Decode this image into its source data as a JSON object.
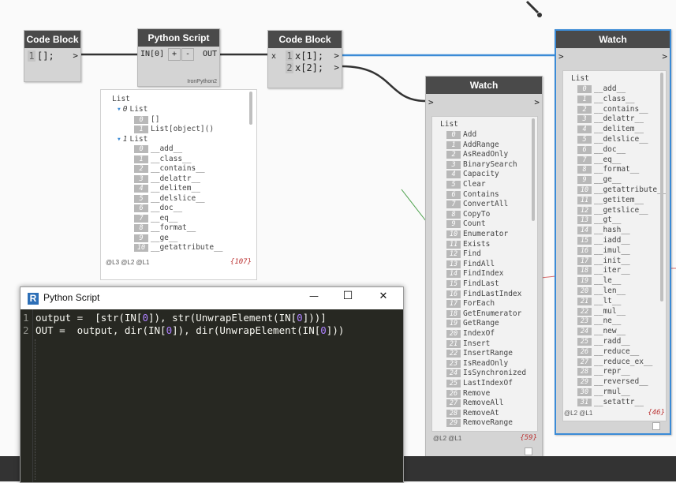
{
  "code_block_1": {
    "title": "Code Block",
    "line_no": "1",
    "code": "[];",
    "out": ">"
  },
  "python_node": {
    "title": "Python Script",
    "in_port": "IN[0]",
    "plus": "+",
    "minus": "-",
    "out_port": "OUT",
    "engine": "IronPython2"
  },
  "code_block_2": {
    "title": "Code Block",
    "in_port": "x",
    "lines": [
      {
        "no": "1",
        "code": "x[1];"
      },
      {
        "no": "2",
        "code": "x[2];"
      }
    ],
    "out": ">"
  },
  "preview": {
    "root": "List",
    "items": [
      {
        "indent": 1,
        "idx": "0",
        "text": "List",
        "branch": true
      },
      {
        "indent": 2,
        "idx": "0",
        "text": "[]"
      },
      {
        "indent": 2,
        "idx": "1",
        "text": "List[object]()"
      },
      {
        "indent": 1,
        "idx": "1",
        "text": "List",
        "branch": true
      },
      {
        "indent": 2,
        "idx": "0",
        "text": "__add__"
      },
      {
        "indent": 2,
        "idx": "1",
        "text": "__class__"
      },
      {
        "indent": 2,
        "idx": "2",
        "text": "__contains__"
      },
      {
        "indent": 2,
        "idx": "3",
        "text": "__delattr__"
      },
      {
        "indent": 2,
        "idx": "4",
        "text": "__delitem__"
      },
      {
        "indent": 2,
        "idx": "5",
        "text": "__delslice__"
      },
      {
        "indent": 2,
        "idx": "6",
        "text": "__doc__"
      },
      {
        "indent": 2,
        "idx": "7",
        "text": "__eq__"
      },
      {
        "indent": 2,
        "idx": "8",
        "text": "__format__"
      },
      {
        "indent": 2,
        "idx": "9",
        "text": "__ge__"
      },
      {
        "indent": 2,
        "idx": "10",
        "text": "__getattribute__"
      }
    ],
    "levels": "@L3 @L2 @L1",
    "count": "{107}"
  },
  "watch_1": {
    "title": "Watch",
    "in": ">",
    "out": ">",
    "root": "List",
    "items": [
      "Add",
      "AddRange",
      "AsReadOnly",
      "BinarySearch",
      "Capacity",
      "Clear",
      "Contains",
      "ConvertAll",
      "CopyTo",
      "Count",
      "Enumerator",
      "Exists",
      "Find",
      "FindAll",
      "FindIndex",
      "FindLast",
      "FindLastIndex",
      "ForEach",
      "GetEnumerator",
      "GetRange",
      "IndexOf",
      "Insert",
      "InsertRange",
      "IsReadOnly",
      "IsSynchronized",
      "LastIndexOf",
      "Remove",
      "RemoveAll",
      "RemoveAt",
      "RemoveRange"
    ],
    "levels": "@L2 @L1",
    "count": "{59}"
  },
  "watch_2": {
    "title": "Watch",
    "in": ">",
    "out": ">",
    "root": "List",
    "items": [
      "__add__",
      "__class__",
      "__contains__",
      "__delattr__",
      "__delitem__",
      "__delslice__",
      "__doc__",
      "__eq__",
      "__format__",
      "__ge__",
      "__getattribute__",
      "__getitem__",
      "__getslice__",
      "__gt__",
      "__hash__",
      "__iadd__",
      "__imul__",
      "__init__",
      "__iter__",
      "__le__",
      "__len__",
      "__lt__",
      "__mul__",
      "__ne__",
      "__new__",
      "__radd__",
      "__reduce__",
      "__reduce_ex__",
      "__repr__",
      "__reversed__",
      "__rmul__",
      "__setattr__"
    ],
    "levels": "@L2 @L1",
    "count": "{46}"
  },
  "python_window": {
    "title": "Python Script",
    "logo": "R",
    "minimize": "—",
    "maximize": "☐",
    "close": "✕",
    "lines": [
      {
        "no": "1",
        "code": "output =  [str(IN[0]), str(UnwrapElement(IN[0]))]"
      },
      {
        "no": "2",
        "code": "OUT =  output, dir(IN[0]), dir(UnwrapElement(IN[0]))"
      }
    ]
  },
  "colors": {
    "accent": "#3b8bd6",
    "node_header": "#4a4a4a",
    "editor_bg": "#272822",
    "number": "#ae81ff"
  }
}
